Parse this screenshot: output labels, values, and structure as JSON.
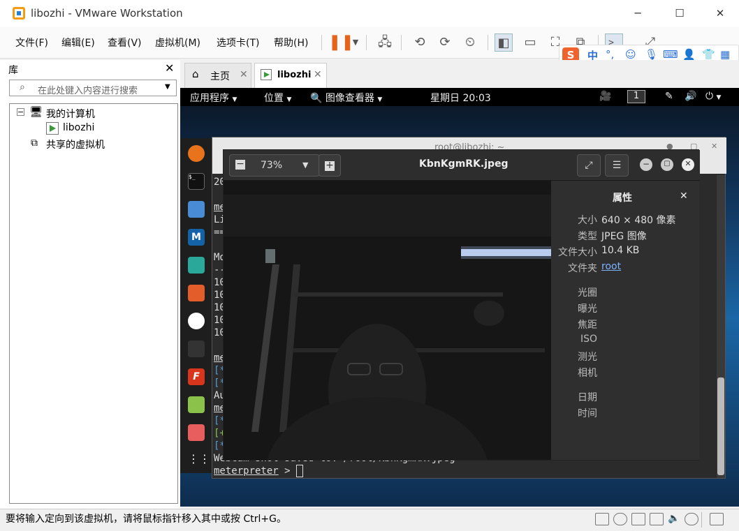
{
  "window": {
    "title": "libozhi - VMware Workstation",
    "minimize": "─",
    "maximize": "☐",
    "close": "✕"
  },
  "menu": [
    "文件(F)",
    "编辑(E)",
    "查看(V)",
    "虚拟机(M)",
    "选项卡(T)",
    "帮助(H)"
  ],
  "ime": {
    "logo": "S",
    "mode": "中",
    "punct": "°,"
  },
  "library": {
    "title": "库",
    "close": "✕",
    "search_placeholder": "在此处键入内容进行搜索",
    "tree": {
      "my_computer": "我的计算机",
      "vm": "libozhi",
      "shared": "共享的虚拟机"
    }
  },
  "tabs": [
    {
      "label": "主页"
    },
    {
      "label": "libozhi"
    }
  ],
  "guest": {
    "topbar": {
      "apps": "应用程序",
      "places": "位置",
      "viewer": "图像查看器",
      "clock": "星期日 20:03",
      "workspace": "1"
    },
    "terminal": {
      "title": "root@libozhi: ~",
      "lines": [
        "20",
        "",
        "me",
        "Li",
        "==",
        "",
        "Mo",
        "--",
        "10",
        "10",
        "10",
        "10",
        "10",
        "",
        "me",
        "[*",
        "[*",
        "Au",
        "me",
        "[*",
        "[+",
        "[*",
        "Webcam shot saved to: /root/KbnKgmRK.jpeg"
      ],
      "prompt_text": "meterpreter",
      "prompt_suffix": " > ",
      "cursor": " "
    },
    "viewer": {
      "zoom": "73%",
      "filename": "KbnKgmRK.jpeg",
      "properties_title": "属性",
      "close": "✕",
      "props": [
        {
          "label": "大小",
          "value": "640 × 480 像素"
        },
        {
          "label": "类型",
          "value": "JPEG 图像"
        },
        {
          "label": "文件大小",
          "value": "10.4 KB"
        },
        {
          "label": "文件夹",
          "value": "root"
        }
      ],
      "exif": [
        "光圈",
        "曝光",
        "焦距",
        "ISO",
        "测光",
        "相机"
      ],
      "datetime": [
        "日期",
        "时间"
      ]
    }
  },
  "statusbar": {
    "message": "要将输入定向到该虚拟机，请将鼠标指针移入其中或按 Ctrl+G。"
  }
}
